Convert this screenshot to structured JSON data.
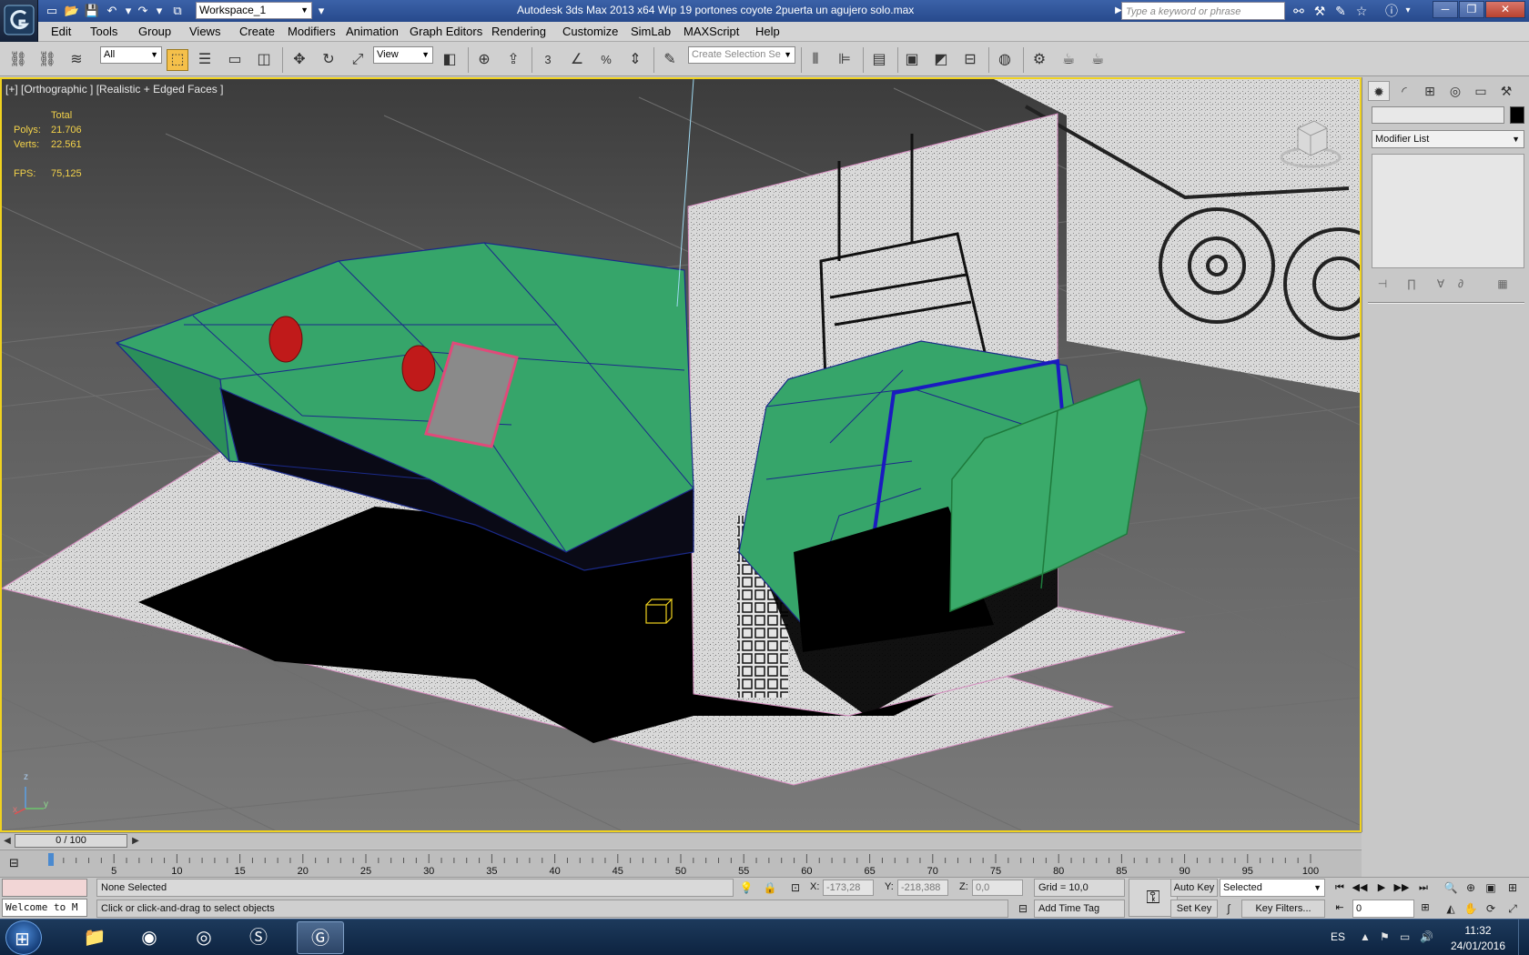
{
  "titlebar": {
    "workspace": "Workspace_1",
    "title": "Autodesk 3ds Max  2013 x64     Wip 19 portones coyote 2puerta un agujero solo.max",
    "search_placeholder": "Type a keyword or phrase",
    "minimize": "─",
    "restore": "❐",
    "close": "✕"
  },
  "menu": [
    "Edit",
    "Tools",
    "Group",
    "Views",
    "Create",
    "Modifiers",
    "Animation",
    "Graph Editors",
    "Rendering",
    "Customize",
    "SimLab",
    "MAXScript",
    "Help"
  ],
  "toolbar": {
    "selection_filter": "All",
    "reference_coord": "View",
    "named_selection_placeholder": "Create Selection Se",
    "snap_3": "3",
    "snap_percent": "%"
  },
  "viewport": {
    "label": "[+] [Orthographic ] [Realistic + Edged Faces ]",
    "stats_header": "Total",
    "polys_label": "Polys:",
    "polys_value": "21.706",
    "verts_label": "Verts:",
    "verts_value": "22.561",
    "fps_label": "FPS:",
    "fps_value": "75,125",
    "axis_z": "z",
    "axis_x": "x",
    "axis_y": "y",
    "colors": {
      "body": "#36a56a",
      "wire": "#1b2a8a",
      "light": "#c01a1a",
      "border": "#f0d21f"
    }
  },
  "command_panel": {
    "modifier_list": "Modifier List"
  },
  "timeline": {
    "frame_label": "0 / 100",
    "ticks": [
      "5",
      "10",
      "15",
      "20",
      "25",
      "30",
      "35",
      "40",
      "45",
      "50",
      "55",
      "60",
      "65",
      "70",
      "75",
      "80",
      "85",
      "90",
      "95",
      "100"
    ]
  },
  "status": {
    "listener": "Welcome to M",
    "selection": "None Selected",
    "prompt": "Click or click-and-drag to select objects",
    "x_label": "X:",
    "x_value": "-173,28",
    "y_label": "Y:",
    "y_value": "-218,388",
    "z_label": "Z:",
    "z_value": "0,0",
    "grid": "Grid = 10,0",
    "add_time_tag": "Add Time Tag",
    "auto_key": "Auto Key",
    "set_key": "Set Key",
    "key_mode": "Selected",
    "key_filters": "Key Filters...",
    "current_frame": "0"
  },
  "taskbar": {
    "lang": "ES",
    "time": "11:32",
    "date": "24/01/2016"
  }
}
